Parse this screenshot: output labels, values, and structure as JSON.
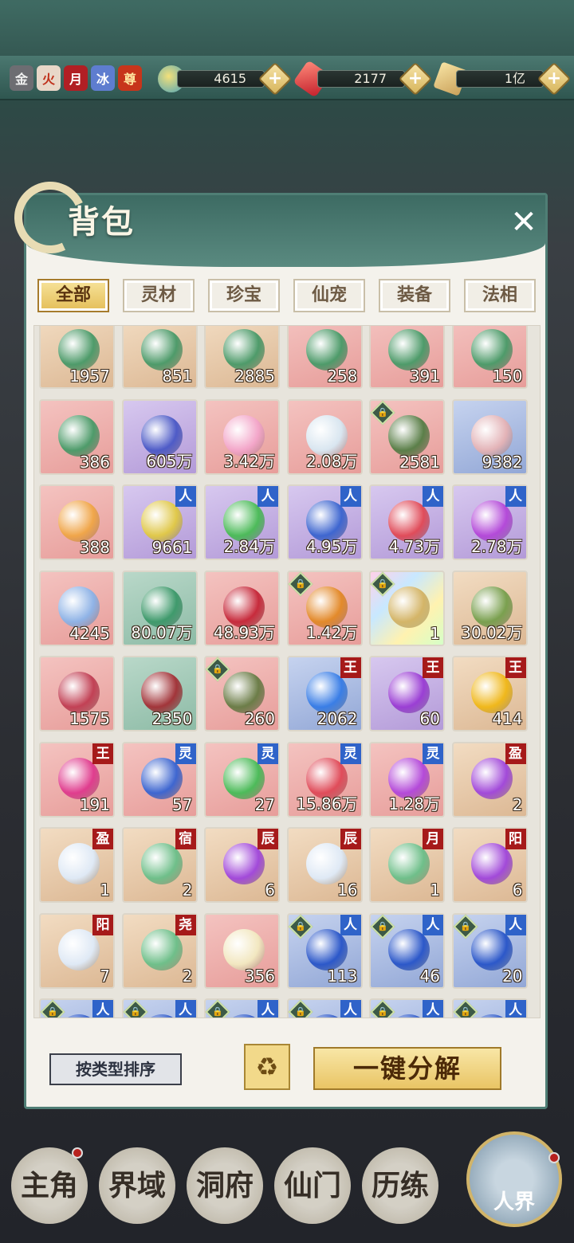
{
  "top_bar": {
    "badges": [
      {
        "label": "金",
        "bg": "#6d6d72",
        "fg": "#f1f1f1"
      },
      {
        "label": "火",
        "bg": "#e8d7c8",
        "fg": "#c0311b"
      },
      {
        "label": "月",
        "bg": "#b11f24",
        "fg": "#fff"
      },
      {
        "label": "冰",
        "bg": "#5e7dcf",
        "fg": "#fff"
      },
      {
        "label": "尊",
        "bg": "#c7351b",
        "fg": "#ffe7a0"
      }
    ],
    "resources": [
      {
        "icon": "spirit-orb-icon",
        "value": "4615",
        "plus": "+"
      },
      {
        "icon": "red-crystal-icon",
        "value": "2177",
        "plus": "+"
      },
      {
        "icon": "scroll-icon",
        "value": "1亿",
        "plus": "+"
      }
    ]
  },
  "panel": {
    "title": "背包",
    "close": "✕",
    "tabs": [
      "全部",
      "灵材",
      "珍宝",
      "仙宠",
      "装备",
      "法相"
    ],
    "active_tab": "全部"
  },
  "items": [
    {
      "qty": "1957",
      "bg": "tan",
      "art": "#4e9b6a"
    },
    {
      "qty": "851",
      "bg": "tan",
      "art": "#4e9b6a"
    },
    {
      "qty": "2885",
      "bg": "tan",
      "art": "#4e9b6a"
    },
    {
      "qty": "258",
      "bg": "red",
      "art": "#4e9b6a"
    },
    {
      "qty": "391",
      "bg": "red",
      "art": "#4e9b6a"
    },
    {
      "qty": "150",
      "bg": "red",
      "art": "#4e9b6a"
    },
    {
      "qty": "386",
      "bg": "red",
      "art": "#4e9b6a"
    },
    {
      "qty": "605万",
      "bg": "purple",
      "art": "#4e5bc7"
    },
    {
      "qty": "3.42万",
      "bg": "red",
      "art": "#f3a6c9"
    },
    {
      "qty": "2.08万",
      "bg": "red",
      "art": "#d9e6f0"
    },
    {
      "qty": "2581",
      "bg": "red",
      "art": "#5b7f49",
      "lock": true
    },
    {
      "qty": "9382",
      "bg": "blue",
      "art": "#e3b3b7"
    },
    {
      "qty": "388",
      "bg": "red",
      "art": "#f0a64a"
    },
    {
      "qty": "9661",
      "bg": "purple",
      "art": "#e0c84a",
      "tag": "人",
      "tag_color": "blue"
    },
    {
      "qty": "2.84万",
      "bg": "purple",
      "art": "#4dbb5a",
      "tag": "人",
      "tag_color": "blue"
    },
    {
      "qty": "4.95万",
      "bg": "purple",
      "art": "#3e66d0",
      "tag": "人",
      "tag_color": "blue"
    },
    {
      "qty": "4.73万",
      "bg": "purple",
      "art": "#e04c5a",
      "tag": "人",
      "tag_color": "blue"
    },
    {
      "qty": "2.78万",
      "bg": "purple",
      "art": "#b44ad9",
      "tag": "人",
      "tag_color": "blue"
    },
    {
      "qty": "4245",
      "bg": "red",
      "art": "#8fb3e6"
    },
    {
      "qty": "80.07万",
      "bg": "green",
      "art": "#3f9a6c"
    },
    {
      "qty": "48.93万",
      "bg": "red",
      "art": "#c72b3c"
    },
    {
      "qty": "1.42万",
      "bg": "red",
      "art": "#e38a2b",
      "lock": true
    },
    {
      "qty": "1",
      "bg": "rainbow",
      "art": "#d4b568",
      "lock": true
    },
    {
      "qty": "30.02万",
      "bg": "tan",
      "art": "#7aa04f"
    },
    {
      "qty": "1575",
      "bg": "red",
      "art": "#c24155"
    },
    {
      "qty": "2350",
      "bg": "green",
      "art": "#a2353a"
    },
    {
      "qty": "260",
      "bg": "red",
      "art": "#6c7d48",
      "lock": true
    },
    {
      "qty": "2062",
      "bg": "blue",
      "art": "#3a7ee6",
      "tag": "王",
      "tag_color": "red"
    },
    {
      "qty": "60",
      "bg": "purple",
      "art": "#9b3fd4",
      "tag": "王",
      "tag_color": "red"
    },
    {
      "qty": "414",
      "bg": "tan",
      "art": "#f0b81c",
      "tag": "王",
      "tag_color": "red"
    },
    {
      "qty": "191",
      "bg": "red",
      "art": "#e03d8e",
      "tag": "王",
      "tag_color": "red"
    },
    {
      "qty": "57",
      "bg": "red",
      "art": "#3e66d0",
      "tag": "灵",
      "tag_color": "blue"
    },
    {
      "qty": "27",
      "bg": "red",
      "art": "#4dbb5a",
      "tag": "灵",
      "tag_color": "blue"
    },
    {
      "qty": "15.86万",
      "bg": "red",
      "art": "#e04c5a",
      "tag": "灵",
      "tag_color": "blue"
    },
    {
      "qty": "1.28万",
      "bg": "red",
      "art": "#b44ad9",
      "tag": "灵",
      "tag_color": "blue"
    },
    {
      "qty": "2",
      "bg": "tan",
      "art": "#a24ad9",
      "tag": "盈",
      "tag_color": "red"
    },
    {
      "qty": "1",
      "bg": "tan",
      "art": "#dfe9f5",
      "tag": "盈",
      "tag_color": "red"
    },
    {
      "qty": "2",
      "bg": "tan",
      "art": "#6fbf8a",
      "tag": "宿",
      "tag_color": "red"
    },
    {
      "qty": "6",
      "bg": "tan",
      "art": "#a24ad9",
      "tag": "辰",
      "tag_color": "red"
    },
    {
      "qty": "16",
      "bg": "tan",
      "art": "#dfe9f5",
      "tag": "辰",
      "tag_color": "red"
    },
    {
      "qty": "1",
      "bg": "tan",
      "art": "#6fbf8a",
      "tag": "月",
      "tag_color": "red"
    },
    {
      "qty": "6",
      "bg": "tan",
      "art": "#a24ad9",
      "tag": "阳",
      "tag_color": "red"
    },
    {
      "qty": "7",
      "bg": "tan",
      "art": "#dfe9f5",
      "tag": "阳",
      "tag_color": "red"
    },
    {
      "qty": "2",
      "bg": "tan",
      "art": "#6fbf8a",
      "tag": "尧",
      "tag_color": "red"
    },
    {
      "qty": "356",
      "bg": "red",
      "art": "#f2e7c0"
    },
    {
      "qty": "113",
      "bg": "blue",
      "art": "#2c58c9",
      "tag": "人",
      "tag_color": "blue",
      "lock": true
    },
    {
      "qty": "46",
      "bg": "blue",
      "art": "#2c58c9",
      "tag": "人",
      "tag_color": "blue",
      "lock": true
    },
    {
      "qty": "20",
      "bg": "blue",
      "art": "#2c58c9",
      "tag": "人",
      "tag_color": "blue",
      "lock": true
    },
    {
      "qty": "",
      "bg": "blue",
      "art": "#2c58c9",
      "tag": "人",
      "tag_color": "blue",
      "lock": true
    },
    {
      "qty": "",
      "bg": "blue",
      "art": "#2c58c9",
      "tag": "人",
      "tag_color": "blue",
      "lock": true
    },
    {
      "qty": "",
      "bg": "blue",
      "art": "#2c58c9",
      "tag": "人",
      "tag_color": "blue",
      "lock": true
    },
    {
      "qty": "",
      "bg": "blue",
      "art": "#2c58c9",
      "tag": "人",
      "tag_color": "blue",
      "lock": true
    },
    {
      "qty": "",
      "bg": "blue",
      "art": "#2c58c9",
      "tag": "人",
      "tag_color": "blue",
      "lock": true
    },
    {
      "qty": "",
      "bg": "blue",
      "art": "#2c58c9",
      "tag": "人",
      "tag_color": "blue",
      "lock": true
    }
  ],
  "actions": {
    "sort_label": "按类型排序",
    "recycle_icon": "♻",
    "decompose_label": "一键分解"
  },
  "bottom_nav": {
    "items": [
      "主角",
      "界域",
      "洞府",
      "仙门",
      "历练"
    ],
    "realm": "人界"
  }
}
